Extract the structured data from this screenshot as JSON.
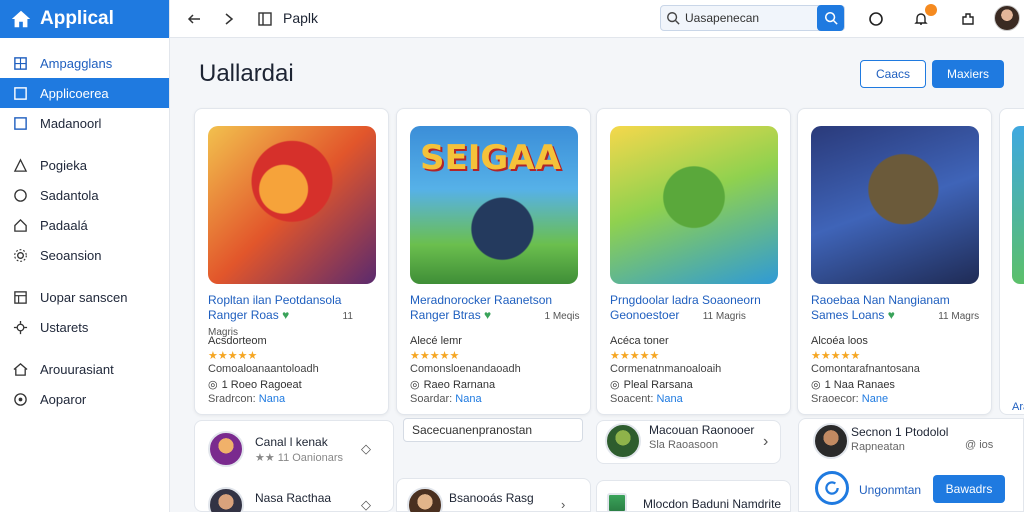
{
  "brand": {
    "name": "Applical"
  },
  "sidebar": {
    "items": [
      {
        "label": "Ampagglans",
        "icon": "grid-icon"
      },
      {
        "label": "Applicoerea",
        "icon": "square-icon",
        "active": true
      },
      {
        "label": "Madanoorl",
        "icon": "square-icon"
      },
      {
        "label": "Pogieka",
        "icon": "triangle-icon"
      },
      {
        "label": "Sadantola",
        "icon": "circle-icon"
      },
      {
        "label": "Padaalá",
        "icon": "home-icon"
      },
      {
        "label": "Seoansion",
        "icon": "settings-icon"
      },
      {
        "label": "Uopar sanscen",
        "icon": "window-icon"
      },
      {
        "label": "Ustarets",
        "icon": "cog-icon"
      },
      {
        "label": "Arouurasiant",
        "icon": "house-icon"
      },
      {
        "label": "Aoparor",
        "icon": "info-icon"
      }
    ]
  },
  "topbar": {
    "title": "Paplk",
    "search_value": "Uasapenecan"
  },
  "main": {
    "title": "Uallardai",
    "button_outline": "Caacs",
    "button_primary": "Maxiers"
  },
  "cards": [
    {
      "title_line1": "Ropltan ilan Peotdansola",
      "title_line2": "Ranger Roas",
      "badge": "♥",
      "rating_count": "11 Magris",
      "rating_label": "Acsdorteom",
      "stars": "★★★★★",
      "desc": "Comoaloanaantoloadh",
      "meta_icon": "◎",
      "meta": "1 Roeo Ragoeat",
      "source_label": "Sradrcon:",
      "source_link": "Nana",
      "art_text": ""
    },
    {
      "title_line1": "Meradnorocker Raanetson",
      "title_line2": "Ranger Btras",
      "badge": "♥",
      "rating_count": "1 Meqis",
      "rating_label": "Alecé lemr",
      "stars": "★★★★★",
      "desc": "Comonsloenandaoadh",
      "meta_icon": "◎",
      "meta": "Raeo Rarnana",
      "source_label": "Soardar:",
      "source_link": "Nana",
      "art_text": "SEIGAA"
    },
    {
      "title_line1": "Prngdoolar ladra Soaoneorn",
      "title_line2": "Geonoestoer",
      "badge": "",
      "rating_count": "11 Magris",
      "rating_label": "Acéca toner",
      "stars": "★★★★★",
      "desc": "Cormenatnmanoaloaih",
      "meta_icon": "◎",
      "meta": "Pleal Rarsana",
      "source_label": "Soacent:",
      "source_link": "Nana",
      "art_text": ""
    },
    {
      "title_line1": "Raoebaa Nan Nangianam",
      "title_line2": "Sames Loans",
      "badge": "♥",
      "rating_count": "11 Magrs",
      "rating_label": "Alcoéa loos",
      "stars": "★★★★★",
      "desc": "Comontarafnantosana",
      "meta_icon": "◎",
      "meta": "1 Naa Ranaes",
      "source_label": "Sraoecor:",
      "source_link": "Nane",
      "art_text": ""
    }
  ],
  "list_rows": [
    {
      "title": "Canal l kenak",
      "sub": "★★ 11 Oanionars"
    },
    {
      "title": "Nasa Racthaa",
      "sub": ""
    },
    {
      "title": "Bsanooás Rasg",
      "sub": ""
    }
  ],
  "search_pill": {
    "text": "Sacecuanenpranostan"
  },
  "suggest": {
    "title": "Macouan Raonooer",
    "sub": "Sla Raoasoon"
  },
  "suggest2": {
    "title": "Mlocdon Baduni Namdrite"
  },
  "profile": {
    "title": "Secnon 1 Ptodolol",
    "sub": "Rapneatan",
    "badge": "@ ios",
    "action_label": "Ungonmtan",
    "action_button": "Bawadrs"
  },
  "right_card": {
    "text": "Ara"
  },
  "colors": {
    "accent": "#1f7ae0",
    "star": "#f5a623",
    "notification": "#f58a1f"
  }
}
